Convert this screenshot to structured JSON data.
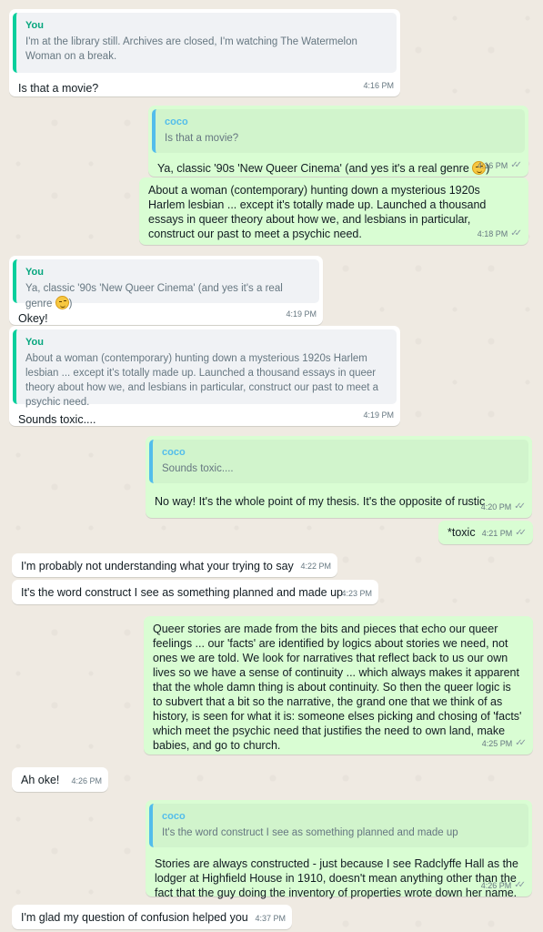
{
  "chat": {
    "messages": [
      {
        "id": "m1",
        "dir": "in",
        "quote": {
          "author": "You",
          "text": "I'm at the library still. Archives are closed, I'm watching The Watermelon Woman on a break."
        },
        "text": "Is that a movie?",
        "time": "4:16 PM"
      },
      {
        "id": "m2",
        "dir": "out",
        "quote": {
          "author": "coco",
          "text": "Is that a movie?"
        },
        "text_before": "Ya, classic '90s 'New Queer Cinema' (and yes it's a real genre ",
        "emoji": "smirking-face",
        "text_after": ")",
        "time": "4:16 PM"
      },
      {
        "id": "m3",
        "dir": "out",
        "text": "About a woman (contemporary) hunting down a mysterious 1920s Harlem lesbian ... except it's totally made up. Launched a thousand essays in queer theory about how we, and lesbians in particular, construct our past to meet a psychic need.",
        "time": "4:18 PM"
      },
      {
        "id": "m4",
        "dir": "in",
        "quote": {
          "author": "You",
          "text_before": "Ya, classic '90s 'New Queer Cinema' (and yes it's a real genre ",
          "emoji": "smirking-face",
          "text_after": ")"
        },
        "text": "Okey!",
        "time": "4:19 PM"
      },
      {
        "id": "m5",
        "dir": "in",
        "quote": {
          "author": "You",
          "text": "About a woman (contemporary) hunting down a mysterious 1920s Harlem lesbian ... except it's totally made up. Launched a thousand essays in queer theory about how we, and lesbians in particular, construct our past to meet a psychic need."
        },
        "text": "Sounds toxic....",
        "time": "4:19 PM"
      },
      {
        "id": "m6",
        "dir": "out",
        "quote": {
          "author": "coco",
          "text": "Sounds toxic...."
        },
        "text": "No way! It's the whole point of my thesis. It's the opposite of rustic",
        "time": "4:20 PM"
      },
      {
        "id": "m7",
        "dir": "out",
        "text": "*toxic",
        "time": "4:21 PM"
      },
      {
        "id": "m8",
        "dir": "in",
        "text": "I'm probably not understanding what your trying to say",
        "time": "4:22 PM"
      },
      {
        "id": "m9",
        "dir": "in",
        "text": "It's the word construct I see as something planned and made up",
        "time": "4:23 PM"
      },
      {
        "id": "m10",
        "dir": "out",
        "text": "Queer stories are made from the bits and pieces that echo our queer feelings ... our 'facts' are identified by logics about stories we need, not ones we are told. We look for narratives that reflect back to us our own lives so we have a sense of continuity ... which always makes it apparent that the whole damn thing is about continuity. So then the queer logic is to subvert that a bit so the narrative, the grand one that we think of as history, is seen for what it is: someone elses picking and chosing of 'facts' which meet the psychic need that justifies the need to own land, make babies, and go to church.",
        "time": "4:25 PM"
      },
      {
        "id": "m11",
        "dir": "in",
        "text": "Ah oke!",
        "time": "4:26 PM"
      },
      {
        "id": "m12",
        "dir": "out",
        "quote": {
          "author": "coco",
          "text": "It's the word construct I see as something planned and made up"
        },
        "text": "Stories are always constructed - just because I see Radclyffe Hall as the lodger at Highfield House in 1910, doesn't mean anything other than the fact that the guy doing the inventory of properties wrote down her name.",
        "time": "4:26 PM"
      },
      {
        "id": "m13",
        "dir": "in",
        "text": "I'm glad my question of confusion helped you",
        "time": "4:37 PM"
      }
    ]
  }
}
